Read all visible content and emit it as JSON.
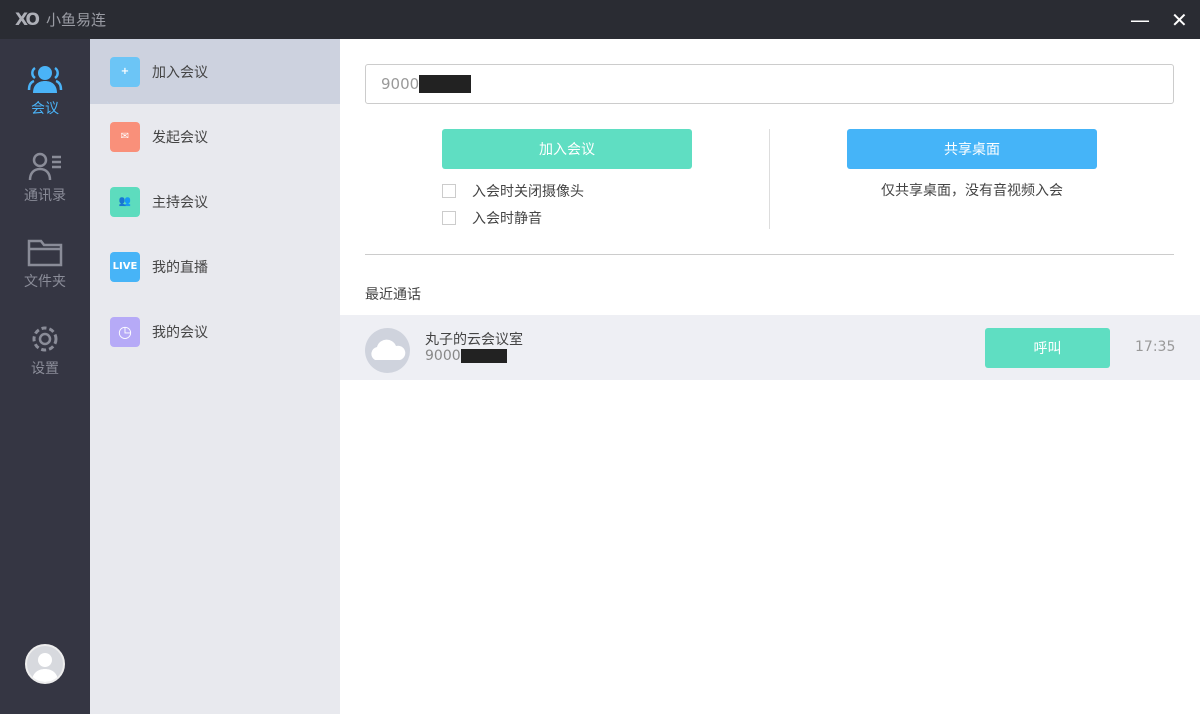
{
  "titlebar": {
    "logo": "XO",
    "title": "小鱼易连",
    "minimize": "—",
    "close": "✕"
  },
  "rail": [
    {
      "label": "会议",
      "icon": "meeting-icon"
    },
    {
      "label": "通讯录",
      "icon": "contacts-icon"
    },
    {
      "label": "文件夹",
      "icon": "folder-icon"
    },
    {
      "label": "设置",
      "icon": "settings-icon"
    }
  ],
  "menu": [
    {
      "label": "加入会议",
      "color": "#6cc5f6",
      "glyph": "+"
    },
    {
      "label": "发起会议",
      "color": "#f9907a",
      "glyph": "✉"
    },
    {
      "label": "主持会议",
      "color": "#5ddcbe",
      "glyph": "👥"
    },
    {
      "label": "我的直播",
      "color": "#47b4f7",
      "glyph": "LIVE"
    },
    {
      "label": "我的会议",
      "color": "#b6aaf7",
      "glyph": "◷"
    }
  ],
  "main": {
    "input_value": "9000",
    "join_button": "加入会议",
    "share_button": "共享桌面",
    "share_hint": "仅共享桌面，没有音视频入会",
    "options": [
      "入会时关闭摄像头",
      "入会时静音"
    ],
    "recent_title": "最近通话",
    "recent": [
      {
        "name": "丸子的云会议室",
        "number": "9000",
        "call": "呼叫",
        "time": "17:35"
      }
    ]
  },
  "colors": {
    "accent": "#4ab3f7",
    "green": "#5fdec2",
    "blue": "#45b4f8"
  }
}
